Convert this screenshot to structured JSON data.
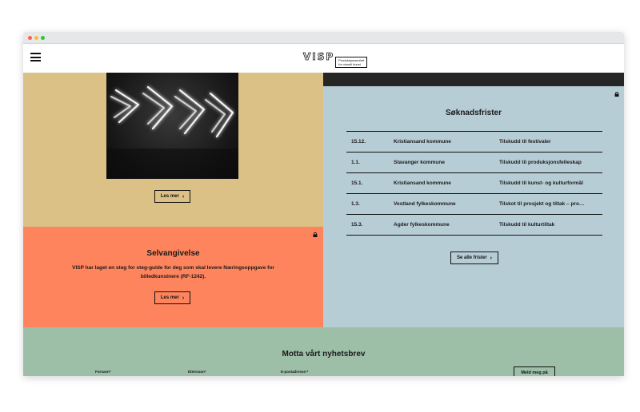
{
  "header": {
    "logo_text": "VISP",
    "logo_subtitle": "Produksjonsenhet\nfor visuell kunst"
  },
  "feature": {
    "image_icon": "neon-arrows-image",
    "button_label": "Les mer"
  },
  "selvangivelse": {
    "title": "Selvangivelse",
    "body": "VISP har laget en steg for steg-guide for deg som skal levere Næringsoppgave for billedkunstnere (RF-1242).",
    "button_label": "Les mer",
    "lock_icon": "lock-icon"
  },
  "deadlines": {
    "title": "Søknadsfrister",
    "lock_icon": "lock-icon",
    "rows": [
      {
        "date": "15.12.",
        "org": "Kristiansand kommune",
        "grant": "Tilskudd til festivaler"
      },
      {
        "date": "1.1.",
        "org": "Stavanger kommune",
        "grant": "Tilskudd til produksjonsfelleskap"
      },
      {
        "date": "15.1.",
        "org": "Kristiansand kommune",
        "grant": "Tilskudd til kunst- og kulturformål"
      },
      {
        "date": "1.3.",
        "org": "Vestland fylkeskommune",
        "grant": "Tilskot til prosjekt og tiltak – pro…"
      },
      {
        "date": "15.3.",
        "org": "Agder fylkeskommune",
        "grant": "Tilskudd til kulturtiltak"
      }
    ],
    "button_label": "Se alle frister"
  },
  "newsletter": {
    "title": "Motta vårt nyhetsbrev",
    "firstname_label": "Fornavn*",
    "lastname_label": "Etternavn*",
    "email_label": "E-postadresse:*",
    "submit_label": "Meld meg på"
  },
  "colors": {
    "tan": "#dbc185",
    "orange": "#fd845c",
    "blue": "#b7cdd6",
    "green": "#9dbfa7",
    "dark": "#262626"
  }
}
